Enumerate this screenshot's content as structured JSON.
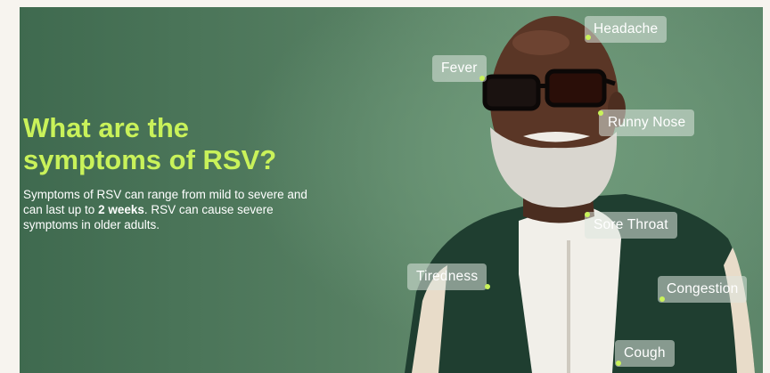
{
  "headline_line1": "What are the",
  "headline_line2": "symptoms of RSV?",
  "body": {
    "part1": "Symptoms of RSV can range from mild to severe and can last up to ",
    "bold": "2 weeks",
    "part2": ". RSV can cause severe symptoms in older adults."
  },
  "symptoms": {
    "headache": "Headache",
    "fever": "Fever",
    "runny_nose": "Runny Nose",
    "sore_throat": "Sore Throat",
    "tiredness": "Tiredness",
    "congestion": "Congestion",
    "cough": "Cough"
  },
  "colors": {
    "accent": "#c9f25a",
    "background_green": "#567f62",
    "jacket": "#1f3e30"
  }
}
